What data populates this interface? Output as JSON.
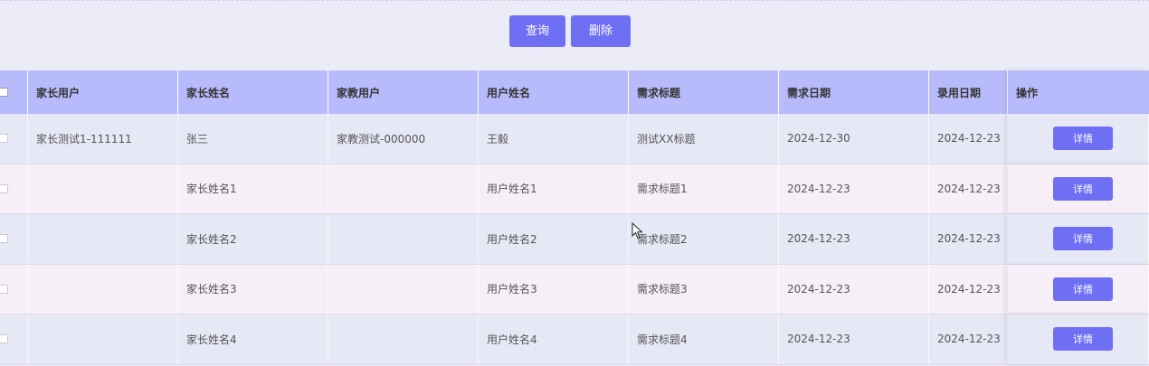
{
  "toolbar": {
    "query_label": "查询",
    "delete_label": "删除"
  },
  "table": {
    "columns": [
      "家长用户",
      "家长姓名",
      "家教用户",
      "用户姓名",
      "需求标题",
      "需求日期",
      "录用日期",
      "操作"
    ],
    "rows": [
      {
        "parent_user": "家长测试1-111111",
        "parent_name": "张三",
        "tutor_user": "家教测试-000000",
        "user_name": "王毅",
        "demand_title": "测试XX标题",
        "demand_date": "2024-12-30",
        "hire_date": "2024-12-23",
        "action": "详情"
      },
      {
        "parent_user": "",
        "parent_name": "家长姓名1",
        "tutor_user": "",
        "user_name": "用户姓名1",
        "demand_title": "需求标题1",
        "demand_date": "2024-12-23",
        "hire_date": "2024-12-23",
        "action": "详情"
      },
      {
        "parent_user": "",
        "parent_name": "家长姓名2",
        "tutor_user": "",
        "user_name": "用户姓名2",
        "demand_title": "需求标题2",
        "demand_date": "2024-12-23",
        "hire_date": "2024-12-23",
        "action": "详情"
      },
      {
        "parent_user": "",
        "parent_name": "家长姓名3",
        "tutor_user": "",
        "user_name": "用户姓名3",
        "demand_title": "需求标题3",
        "demand_date": "2024-12-23",
        "hire_date": "2024-12-23",
        "action": "详情"
      },
      {
        "parent_user": "",
        "parent_name": "家长姓名4",
        "tutor_user": "",
        "user_name": "用户姓名4",
        "demand_title": "需求标题4",
        "demand_date": "2024-12-23",
        "hire_date": "2024-12-23",
        "action": "详情"
      }
    ]
  },
  "colors": {
    "accent": "#6f6ff4",
    "header_bg": "#b8bbfb",
    "row_odd": "#e6e8f6",
    "row_even": "#f7eff7",
    "page_bg": "#ecebf8"
  }
}
